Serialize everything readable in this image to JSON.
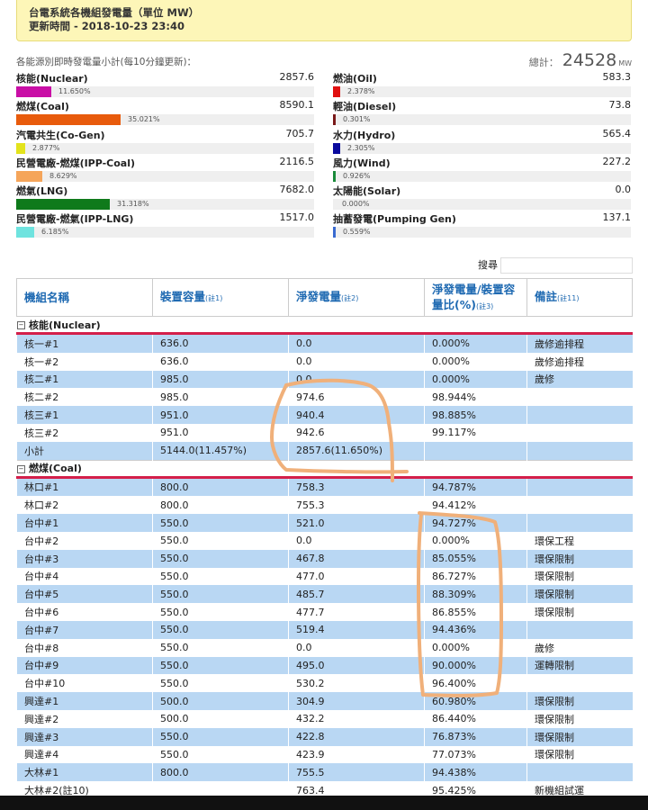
{
  "header": {
    "title": "台電系統各機組發電量（單位 MW）",
    "updated": "更新時間 - 2018-10-23 23:40"
  },
  "summary": {
    "label": "各能源別即時發電量小計(每10分鐘更新)：",
    "total_label": "總計：",
    "total_value": "24528",
    "total_unit": "MW"
  },
  "sources_left": [
    {
      "name": "核能(Nuclear)",
      "value": "2857.6",
      "pct": "11.650%",
      "fraction": 0.1165,
      "color": "#c90fa6"
    },
    {
      "name": "燃煤(Coal)",
      "value": "8590.1",
      "pct": "35.021%",
      "fraction": 0.35021,
      "color": "#e85b0c"
    },
    {
      "name": "汽電共生(Co-Gen)",
      "value": "705.7",
      "pct": "2.877%",
      "fraction": 0.02877,
      "color": "#e3e31c"
    },
    {
      "name": "民營電廠-燃煤(IPP-Coal)",
      "value": "2116.5",
      "pct": "8.629%",
      "fraction": 0.08629,
      "color": "#f5a55a"
    },
    {
      "name": "燃氣(LNG)",
      "value": "7682.0",
      "pct": "31.318%",
      "fraction": 0.31318,
      "color": "#0f7a1b"
    },
    {
      "name": "民營電廠-燃氣(IPP-LNG)",
      "value": "1517.0",
      "pct": "6.185%",
      "fraction": 0.06185,
      "color": "#6fe3df"
    }
  ],
  "sources_right": [
    {
      "name": "燃油(Oil)",
      "value": "583.3",
      "pct": "2.378%",
      "fraction": 0.02378,
      "color": "#e01010"
    },
    {
      "name": "輕油(Diesel)",
      "value": "73.8",
      "pct": "0.301%",
      "fraction": 0.00301,
      "color": "#7a1a1a"
    },
    {
      "name": "水力(Hydro)",
      "value": "565.4",
      "pct": "2.305%",
      "fraction": 0.02305,
      "color": "#0a0a9e"
    },
    {
      "name": "風力(Wind)",
      "value": "227.2",
      "pct": "0.926%",
      "fraction": 0.00926,
      "color": "#1a8a3a"
    },
    {
      "name": "太陽能(Solar)",
      "value": "0.0",
      "pct": "0.000%",
      "fraction": 0,
      "color": "#f5d000"
    },
    {
      "name": "抽蓄發電(Pumping Gen)",
      "value": "137.1",
      "pct": "0.559%",
      "fraction": 0.00559,
      "color": "#3a6ad0"
    }
  ],
  "search": {
    "label": "搜尋"
  },
  "table": {
    "headers": [
      {
        "label": "機組名稱",
        "note": ""
      },
      {
        "label": "裝置容量",
        "note": "(註1)"
      },
      {
        "label": "淨發電量",
        "note": "(註2)"
      },
      {
        "label": "淨發電量/裝置容量比(%)",
        "note": "(註3)"
      },
      {
        "label": "備註",
        "note": "(註11)"
      }
    ],
    "groups": [
      {
        "name": "核能(Nuclear)",
        "toggle": "−",
        "rows": [
          [
            "核一#1",
            "636.0",
            "0.0",
            "0.000%",
            "歲修逾排程"
          ],
          [
            "核一#2",
            "636.0",
            "0.0",
            "0.000%",
            "歲修逾排程"
          ],
          [
            "核二#1",
            "985.0",
            "0.0",
            "0.000%",
            "歲修"
          ],
          [
            "核二#2",
            "985.0",
            "974.6",
            "98.944%",
            ""
          ],
          [
            "核三#1",
            "951.0",
            "940.4",
            "98.885%",
            ""
          ],
          [
            "核三#2",
            "951.0",
            "942.6",
            "99.117%",
            ""
          ],
          [
            "小計",
            "5144.0(11.457%)",
            "2857.6(11.650%)",
            "",
            ""
          ]
        ]
      },
      {
        "name": "燃煤(Coal)",
        "toggle": "−",
        "rows": [
          [
            "林口#1",
            "800.0",
            "758.3",
            "94.787%",
            ""
          ],
          [
            "林口#2",
            "800.0",
            "755.3",
            "94.412%",
            ""
          ],
          [
            "台中#1",
            "550.0",
            "521.0",
            "94.727%",
            ""
          ],
          [
            "台中#2",
            "550.0",
            "0.0",
            "0.000%",
            "環保工程"
          ],
          [
            "台中#3",
            "550.0",
            "467.8",
            "85.055%",
            "環保限制"
          ],
          [
            "台中#4",
            "550.0",
            "477.0",
            "86.727%",
            "環保限制"
          ],
          [
            "台中#5",
            "550.0",
            "485.7",
            "88.309%",
            "環保限制"
          ],
          [
            "台中#6",
            "550.0",
            "477.7",
            "86.855%",
            "環保限制"
          ],
          [
            "台中#7",
            "550.0",
            "519.4",
            "94.436%",
            ""
          ],
          [
            "台中#8",
            "550.0",
            "0.0",
            "0.000%",
            "歲修"
          ],
          [
            "台中#9",
            "550.0",
            "495.0",
            "90.000%",
            "運轉限制"
          ],
          [
            "台中#10",
            "550.0",
            "530.2",
            "96.400%",
            ""
          ],
          [
            "興達#1",
            "500.0",
            "304.9",
            "60.980%",
            "環保限制"
          ],
          [
            "興達#2",
            "500.0",
            "432.2",
            "86.440%",
            "環保限制"
          ],
          [
            "興達#3",
            "550.0",
            "422.8",
            "76.873%",
            "環保限制"
          ],
          [
            "興達#4",
            "550.0",
            "423.9",
            "77.073%",
            "環保限制"
          ],
          [
            "大林#1",
            "800.0",
            "755.5",
            "94.438%",
            ""
          ],
          [
            "大林#2(註10)",
            "",
            "763.4",
            "95.425%",
            "新機組試運"
          ]
        ]
      }
    ]
  },
  "annotation_color": "#f0b07a"
}
